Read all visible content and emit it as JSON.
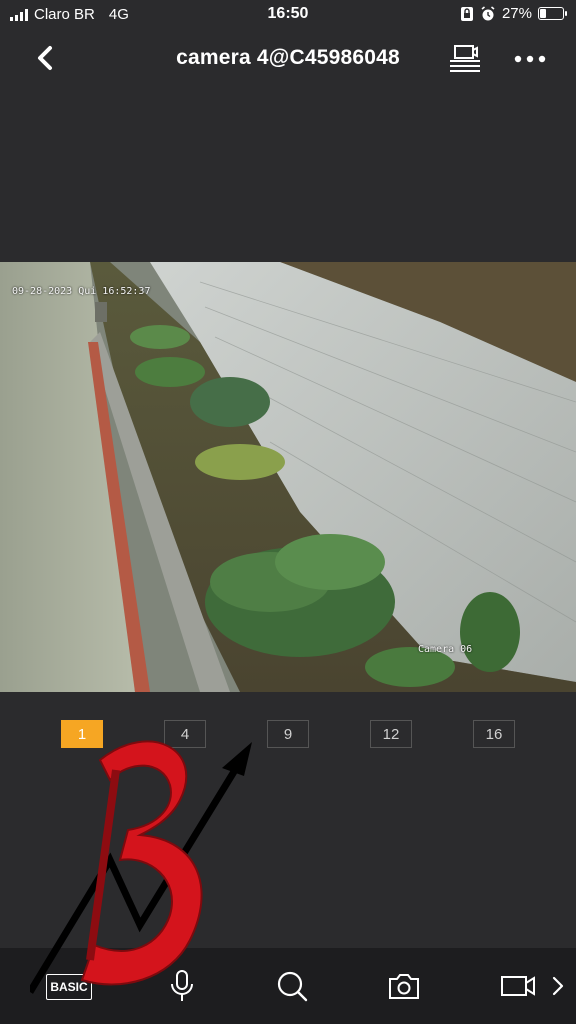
{
  "status_bar": {
    "carrier": "Claro BR",
    "network": "4G",
    "time": "16:50",
    "battery_percent": "27%",
    "battery_level": 0.27
  },
  "nav": {
    "title": "camera 4@C45986048",
    "back_icon": "chevron-left-icon",
    "screen_icon": "screen-mirror-icon",
    "more_icon": "more-horizontal-icon"
  },
  "video": {
    "timestamp_osd": "09-28-2023 Qui 16:52:37",
    "camera_label_osd": "Camera 06"
  },
  "split_tabs": [
    {
      "label": "1",
      "active": true
    },
    {
      "label": "4",
      "active": false
    },
    {
      "label": "9",
      "active": false
    },
    {
      "label": "12",
      "active": false
    },
    {
      "label": "16",
      "active": false
    }
  ],
  "toolbar": {
    "basic_label": "BASIC",
    "tools": [
      "mic-icon",
      "search-icon",
      "camera-snapshot-icon",
      "video-record-icon",
      "chevron-right-icon"
    ]
  },
  "colors": {
    "accent": "#f6a623",
    "background": "#2b2b2d",
    "toolbar": "#1d1d1f",
    "watermark_red": "#d4141c"
  }
}
